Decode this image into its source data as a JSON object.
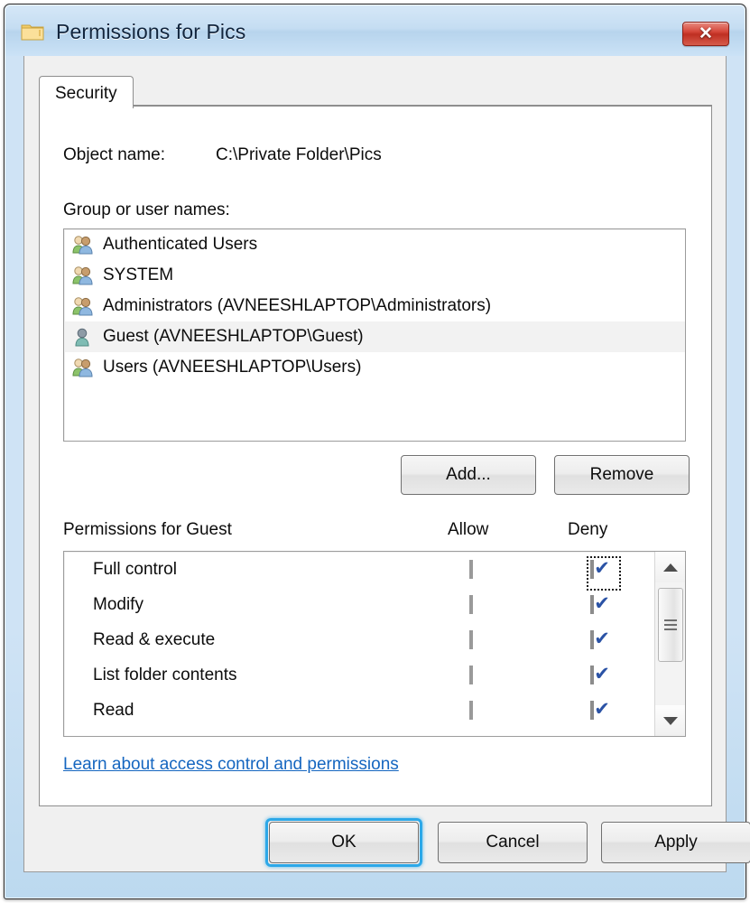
{
  "window": {
    "title": "Permissions for Pics",
    "folder_icon": "folder-icon",
    "close_label": "✕"
  },
  "tabs": [
    {
      "label": "Security",
      "active": true
    }
  ],
  "object": {
    "name_label": "Object name:",
    "name_value": "C:\\Private Folder\\Pics"
  },
  "group_list": {
    "label": "Group or user names:",
    "items": [
      {
        "label": "Authenticated Users",
        "icon": "group-icon",
        "selected": false
      },
      {
        "label": "SYSTEM",
        "icon": "group-icon",
        "selected": false
      },
      {
        "label": "Administrators (AVNEESHLAPTOP\\Administrators)",
        "icon": "group-icon",
        "selected": false
      },
      {
        "label": "Guest (AVNEESHLAPTOP\\Guest)",
        "icon": "user-icon",
        "selected": true
      },
      {
        "label": "Users (AVNEESHLAPTOP\\Users)",
        "icon": "group-icon",
        "selected": false
      }
    ]
  },
  "list_buttons": {
    "add": "Add...",
    "remove": "Remove"
  },
  "permissions": {
    "label": "Permissions for Guest",
    "columns": {
      "allow": "Allow",
      "deny": "Deny"
    },
    "rows": [
      {
        "label": "Full control",
        "allow": false,
        "deny": true,
        "allow_disabled": true,
        "focused": true
      },
      {
        "label": "Modify",
        "allow": false,
        "deny": true,
        "allow_disabled": true,
        "focused": false
      },
      {
        "label": "Read & execute",
        "allow": false,
        "deny": true,
        "allow_disabled": true,
        "focused": false
      },
      {
        "label": "List folder contents",
        "allow": false,
        "deny": true,
        "allow_disabled": true,
        "focused": false
      },
      {
        "label": "Read",
        "allow": false,
        "deny": true,
        "allow_disabled": true,
        "focused": false
      }
    ],
    "check_glyph": "✔",
    "scrollbar": {
      "up": "scroll-up-arrow",
      "down": "scroll-down-arrow"
    }
  },
  "help_link": "Learn about access control and permissions",
  "footer": {
    "ok": "OK",
    "cancel": "Cancel",
    "apply": "Apply"
  },
  "colors": {
    "titlebar": "#c5ddf2",
    "close_red": "#d5473a",
    "link_blue": "#1566c0",
    "check_blue": "#2a52a5",
    "focus_blue": "#2ca8e8",
    "selection_gray": "#f2f2f2"
  }
}
